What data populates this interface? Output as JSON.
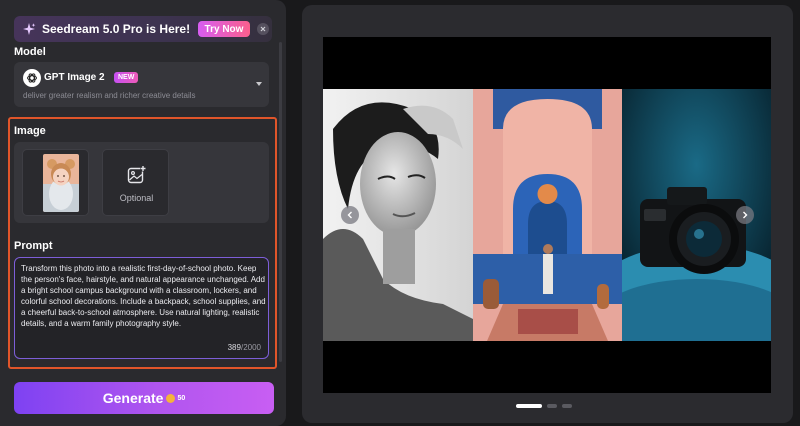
{
  "banner": {
    "text": "Seedream 5.0 Pro is Here!",
    "cta": "Try Now",
    "icon": "sparkle-icon"
  },
  "model": {
    "section_title": "Model",
    "name": "GPT Image 2",
    "badge": "NEW",
    "description": "deliver greater realism and richer creative details"
  },
  "image": {
    "section_title": "Image",
    "optional_label": "Optional"
  },
  "prompt": {
    "section_title": "Prompt",
    "text": "Transform this  photo into a realistic first-day-of-school photo. Keep the person's face, hairstyle, and natural appearance unchanged. Add a bright school campus background with a classroom, lockers, and colorful school decorations. Include a backpack, school supplies, and a cheerful back-to-school atmosphere. Use natural lighting, realistic details, and a warm family photography style.",
    "count": "389",
    "max": "/2000"
  },
  "generate": {
    "label": "Generate",
    "cost": "50"
  },
  "colors": {
    "accent_start": "#7e42f2",
    "accent_end": "#c85ef3",
    "highlight": "#e0552a",
    "try_now": "#fb5f8c"
  },
  "carousel": {
    "slides": [
      "bw-portrait",
      "pink-blue-hallway",
      "camera-on-blue-fur"
    ],
    "active_index": 0,
    "total": 3
  }
}
